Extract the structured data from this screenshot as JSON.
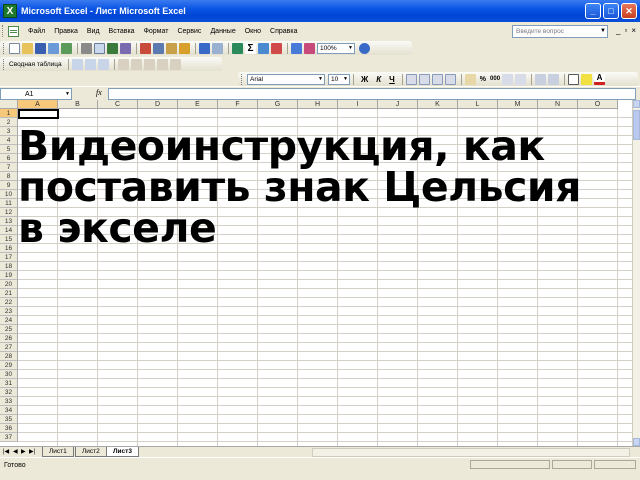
{
  "window": {
    "title": "Microsoft Excel - Лист Microsoft Excel",
    "app_icon": "excel-x-icon",
    "controls": [
      "minimize-icon",
      "maximize-icon",
      "close-icon"
    ]
  },
  "menubar": {
    "items": [
      "Файл",
      "Правка",
      "Вид",
      "Вставка",
      "Формат",
      "Сервис",
      "Данные",
      "Окно",
      "Справка"
    ],
    "help_placeholder": "Введите вопрос"
  },
  "toolbar": {
    "zoom": "100%",
    "pivot_label": "Сводная таблица",
    "font_name": "Arial",
    "font_size": "10",
    "bold": "Ж",
    "italic": "К",
    "underline": "Ч",
    "percent": "%",
    "thousands": "000"
  },
  "formula_bar": {
    "name_box": "A1",
    "fx_label": "fx",
    "value": ""
  },
  "grid": {
    "columns": [
      "A",
      "B",
      "C",
      "D",
      "E",
      "F",
      "G",
      "H",
      "I",
      "J",
      "K",
      "L",
      "M",
      "N",
      "O"
    ],
    "rows": [
      "1",
      "2",
      "3",
      "4",
      "5",
      "6",
      "7",
      "8",
      "9",
      "10",
      "11",
      "12",
      "13",
      "14",
      "15",
      "16",
      "17",
      "18",
      "19",
      "20",
      "21",
      "22",
      "23",
      "24",
      "25",
      "26",
      "27",
      "28",
      "29",
      "30",
      "31",
      "32",
      "33",
      "34",
      "35",
      "36",
      "37"
    ],
    "active_cell": "A1"
  },
  "overlay": {
    "line1": "Видеоинструкция, как",
    "line2": "поставить знак Цельсия",
    "line3": "в экселе"
  },
  "sheets": {
    "tabs": [
      "Лист1",
      "Лист2",
      "Лист3"
    ],
    "active": "Лист3"
  },
  "status": {
    "text": "Готово"
  },
  "colors": {
    "titlebar": "#0a55e3",
    "chrome": "#ece9d8",
    "active_header": "#f7c77a",
    "gridline": "#d4d0c8"
  }
}
